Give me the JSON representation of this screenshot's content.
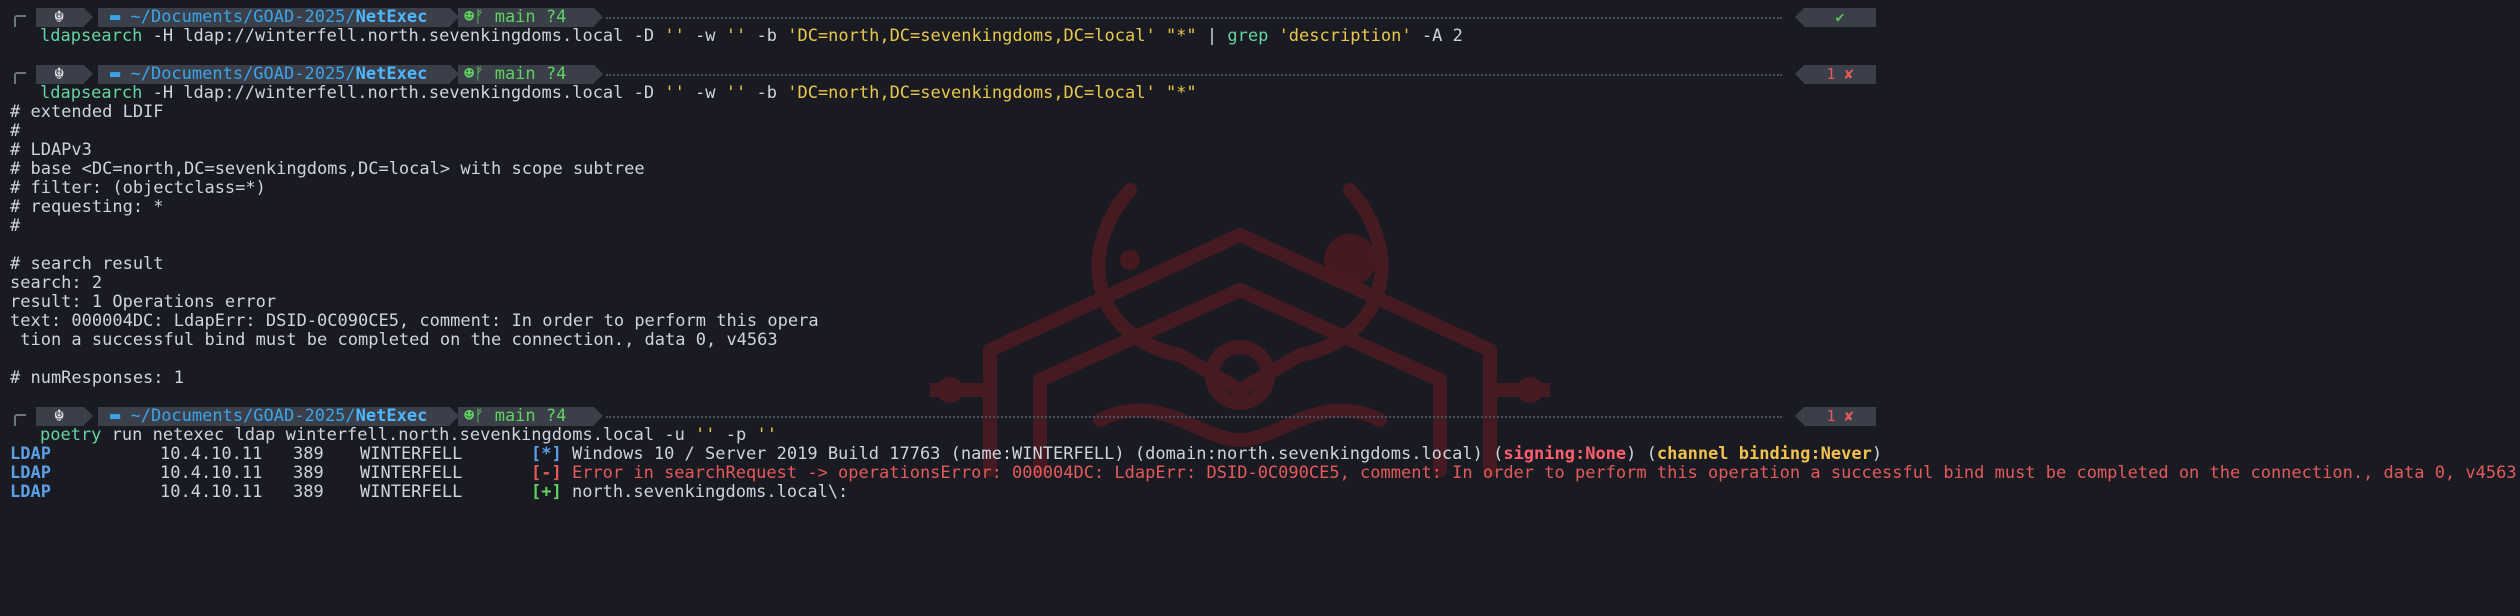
{
  "theme": {
    "bg": "#1a1b22",
    "accent_blue": "#3aa4e8",
    "git_green": "#5fd25f",
    "error_red": "#e45a5a",
    "string_yellow": "#e8c84a",
    "watermark": "#5a1e24"
  },
  "prompt": {
    "os_icon": "kali-dragon-icon",
    "folder_icon": "folder-icon",
    "path_prefix": "~/Documents/GOAD-2025/",
    "path_dir": "NetExec",
    "git_icon": "github-cat-icon",
    "branch_glyph": "ᚠ",
    "branch": "main",
    "changes": "?4"
  },
  "blocks": [
    {
      "status_ok": "✔",
      "cmd": "ldapsearch",
      "args_plain1": " -H ldap://winterfell.north.sevenkingdoms.local -D ",
      "args_str1": "''",
      "args_plain2": " -w ",
      "args_str2": "''",
      "args_plain3": " -b ",
      "args_str3": "'DC=north,DC=sevenkingdoms,DC=local'",
      "args_plain4": " ",
      "args_str4": "\"*\"",
      "pipe": " | ",
      "cmd2": "grep",
      "args_str5": " 'description'",
      "args_plain5": " -A 2"
    },
    {
      "status_code": "1",
      "status_x": "✘",
      "cmd": "ldapsearch",
      "args_plain1": " -H ldap://winterfell.north.sevenkingdoms.local -D ",
      "args_str1": "''",
      "args_plain2": " -w ",
      "args_str2": "''",
      "args_plain3": " -b ",
      "args_str3": "'DC=north,DC=sevenkingdoms,DC=local'",
      "args_plain4": " ",
      "args_str4": "\"*\"",
      "output": [
        "# extended LDIF",
        "#",
        "# LDAPv3",
        "# base <DC=north,DC=sevenkingdoms,DC=local> with scope subtree",
        "# filter: (objectclass=*)",
        "# requesting: *",
        "#",
        "",
        "# search result",
        "search: 2",
        "result: 1 Operations error",
        "text: 000004DC: LdapErr: DSID-0C090CE5, comment: In order to perform this opera",
        " tion a successful bind must be completed on the connection., data 0, v4563",
        "",
        "# numResponses: 1"
      ]
    },
    {
      "status_code": "1",
      "status_x": "✘",
      "cmd": "poetry",
      "args_plain1": " run netexec ldap winterfell.north.sevenkingdoms.local -u ",
      "args_str1": "''",
      "args_plain2": " -p ",
      "args_str2": "''",
      "nxc_rows": [
        {
          "proto": "LDAP",
          "ip": "10.4.10.11",
          "port": "389",
          "host": "WINTERFELL",
          "tag": "[*]",
          "msg": " Windows 10 / Server 2019 Build 17763 (name:WINTERFELL) (domain:north.sevenkingdoms.local) (",
          "signing": "signing:None",
          "mid": ") (",
          "binding": "channel binding:Never",
          "end": ")"
        },
        {
          "proto": "LDAP",
          "ip": "10.4.10.11",
          "port": "389",
          "host": "WINTERFELL",
          "tag": "[-]",
          "msg": " Error in searchRequest -> operationsError: 000004DC: LdapErr: DSID-0C090CE5, comment: In order to perform this operation a successful bind must be completed on the connection., data 0, v4563"
        },
        {
          "proto": "LDAP",
          "ip": "10.4.10.11",
          "port": "389",
          "host": "WINTERFELL",
          "tag": "[+]",
          "msg": " north.sevenkingdoms.local\\:"
        }
      ]
    }
  ]
}
